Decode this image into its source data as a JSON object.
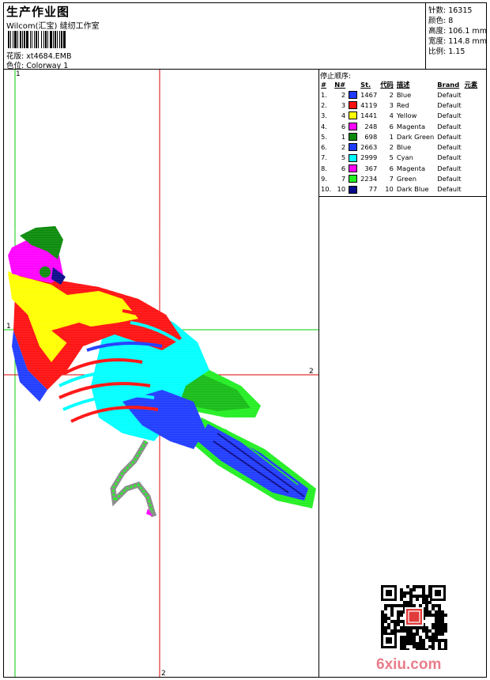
{
  "header": {
    "title": "生产作业图",
    "company": "Wilcom(汇宝) 缝纫工作室",
    "design_label": "花版: xt4684.EMB",
    "colorway_label": "色位: Colorway 1"
  },
  "specs": [
    {
      "label": "针数: 16315"
    },
    {
      "label": "颜色: 8"
    },
    {
      "label": "高度: 106.1 mm"
    },
    {
      "label": "宽度: 114.8 mm"
    },
    {
      "label": "比例: 1.15"
    }
  ],
  "sequence": {
    "title": "停止顺序:",
    "headers": [
      "#",
      "N#",
      "St.",
      "代码",
      "描述",
      "Brand",
      "元素"
    ],
    "rows": [
      {
        "idx": "1.",
        "n": "2",
        "color": "#1f3bff",
        "st": "1467",
        "code": "2",
        "desc": "Blue",
        "brand": "Default"
      },
      {
        "idx": "2.",
        "n": "3",
        "color": "#ff1010",
        "st": "4119",
        "code": "3",
        "desc": "Red",
        "brand": "Default"
      },
      {
        "idx": "3.",
        "n": "4",
        "color": "#ffff00",
        "st": "1441",
        "code": "4",
        "desc": "Yellow",
        "brand": "Default"
      },
      {
        "idx": "4.",
        "n": "6",
        "color": "#ff00ff",
        "st": "248",
        "code": "6",
        "desc": "Magenta",
        "brand": "Default"
      },
      {
        "idx": "5.",
        "n": "1",
        "color": "#0a8a0a",
        "st": "698",
        "code": "1",
        "desc": "Dark Green",
        "brand": "Default"
      },
      {
        "idx": "6.",
        "n": "2",
        "color": "#1f3bff",
        "st": "2663",
        "code": "2",
        "desc": "Blue",
        "brand": "Default"
      },
      {
        "idx": "7.",
        "n": "5",
        "color": "#00ffff",
        "st": "2999",
        "code": "5",
        "desc": "Cyan",
        "brand": "Default"
      },
      {
        "idx": "8.",
        "n": "6",
        "color": "#ff00ff",
        "st": "367",
        "code": "6",
        "desc": "Magenta",
        "brand": "Default"
      },
      {
        "idx": "9.",
        "n": "7",
        "color": "#22ee22",
        "st": "2234",
        "code": "7",
        "desc": "Green",
        "brand": "Default"
      },
      {
        "idx": "10.",
        "n": "10",
        "color": "#0a0a8a",
        "st": "77",
        "code": "10",
        "desc": "Dark Blue",
        "brand": "Default"
      }
    ]
  },
  "guides": {
    "marker_1_top": "1",
    "marker_1_left": "1",
    "marker_2_right": "2",
    "marker_2_bottom": "2"
  },
  "watermark": "6xiu.com",
  "colors": {
    "guide_green": "#00cc00",
    "guide_red": "#dd0000"
  }
}
